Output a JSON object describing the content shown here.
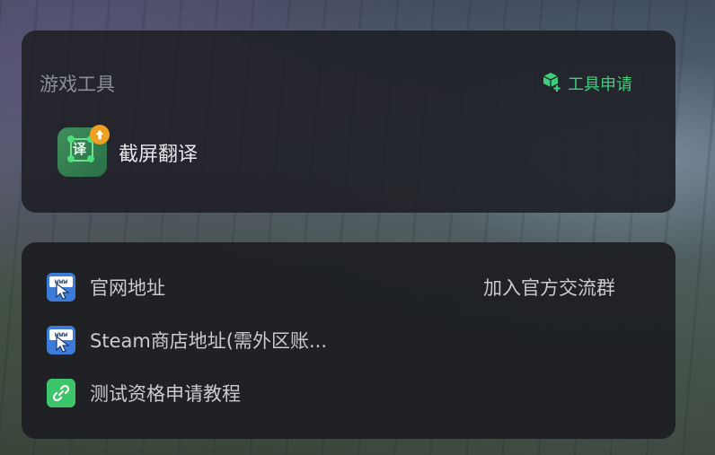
{
  "game_tools": {
    "title": "游戏工具",
    "apply_label": "工具申请",
    "apply_icon": "cube-plus-icon",
    "accent_color": "#3fcf7c",
    "items": [
      {
        "label": "截屏翻译",
        "icon": "screenshot-translate-icon",
        "icon_glyph": "译"
      }
    ]
  },
  "links": {
    "items": [
      {
        "label": "官网地址",
        "icon": "www-cursor-icon",
        "icon_text": "www"
      },
      {
        "label": "Steam商店地址(需外区账...",
        "icon": "www-cursor-icon",
        "icon_text": "www"
      },
      {
        "label": "测试资格申请教程",
        "icon": "link-icon"
      }
    ],
    "join_group_label": "加入官方交流群"
  }
}
